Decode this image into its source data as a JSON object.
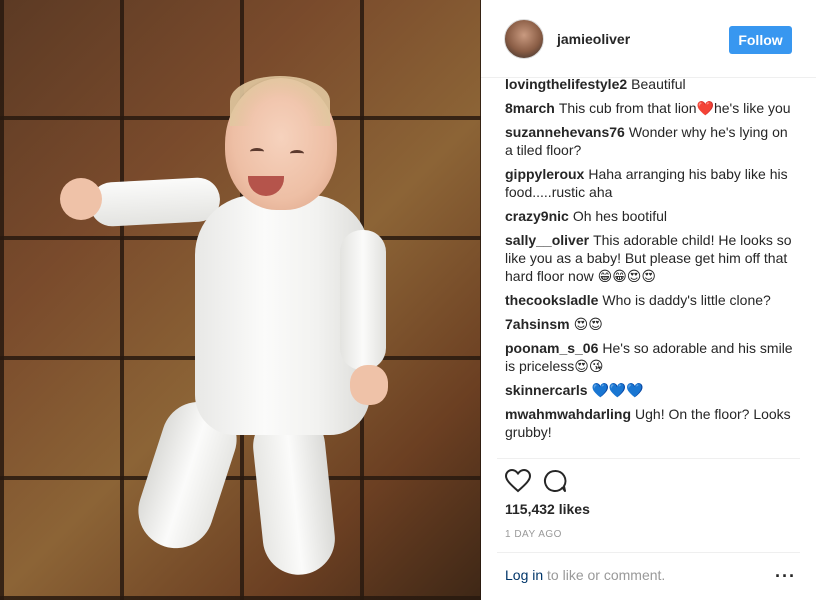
{
  "post": {
    "username": "jamieoliver",
    "follow_label": "Follow",
    "likes": "115,432 likes",
    "time": "1 DAY AGO",
    "login_link": "Log in",
    "login_rest": " to like or comment.",
    "more": "···",
    "photo_alt": "Smiling baby in white onesie lying on terracotta tiles"
  },
  "comments": [
    {
      "user": "lovingthelifestyle2",
      "text": "Beautiful"
    },
    {
      "user": "8march",
      "text": "This cub from that lion❤️he's like you"
    },
    {
      "user": "suzannehevans76",
      "text": "Wonder why he's lying on a tiled floor?"
    },
    {
      "user": "gippyleroux",
      "text": "Haha arranging his baby like his food.....rustic aha"
    },
    {
      "user": "crazy9nic",
      "text": "Oh hes bootiful"
    },
    {
      "user": "sally__oliver",
      "text": "This adorable child! He looks so like you as a baby! But please get him off that hard floor now 😁😁😍😍"
    },
    {
      "user": "thecooksladle",
      "text": "Who is daddy's little clone?"
    },
    {
      "user": "7ahsinsm",
      "text": "😍😍"
    },
    {
      "user": "poonam_s_06",
      "text": "He's so adorable and his smile is priceless😍😘"
    },
    {
      "user": "skinnercarls",
      "text": "💙💙💙"
    },
    {
      "user": "mwahmwahdarling",
      "text": "Ugh! On the floor? Looks grubby!"
    }
  ],
  "colors": {
    "follow_bg": "#3897f0",
    "link": "#003569",
    "muted": "#999999"
  }
}
